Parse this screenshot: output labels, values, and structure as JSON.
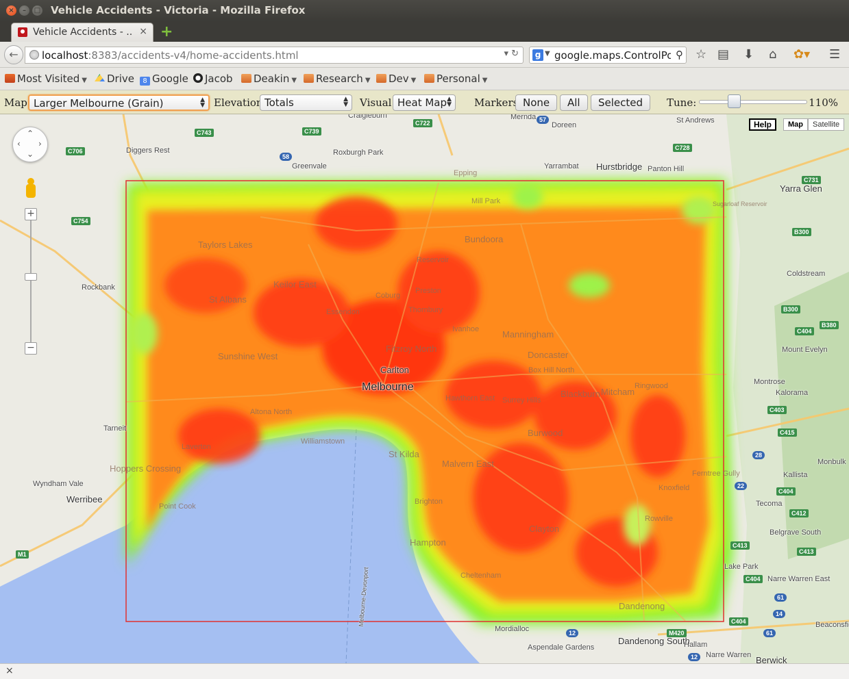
{
  "window": {
    "title": "Vehicle Accidents - Victoria - Mozilla Firefox",
    "close_glyph": "×",
    "min_glyph": "–",
    "max_glyph": "□"
  },
  "tab": {
    "title": "Vehicle Accidents - ...",
    "close": "×",
    "newtab": "+"
  },
  "navbar": {
    "url_host": "localhost",
    "url_path": ":8383/accidents-v4/home-accidents.html",
    "search_engine": "g",
    "search_text": "google.maps.ControlPositi",
    "icons": [
      "star-icon",
      "reading-list-icon",
      "download-icon",
      "home-icon",
      "extension-icon",
      "menu-icon"
    ]
  },
  "bookmarks": [
    {
      "label": "Most Visited",
      "icon": "visited",
      "dropdown": true
    },
    {
      "label": "Drive",
      "icon": "drive",
      "dropdown": false
    },
    {
      "label": "Google",
      "icon": "google",
      "dropdown": false
    },
    {
      "label": "Jacob",
      "icon": "jacob",
      "dropdown": false
    },
    {
      "label": "Deakin",
      "icon": "folder",
      "dropdown": true
    },
    {
      "label": "Research",
      "icon": "folder",
      "dropdown": true
    },
    {
      "label": "Dev",
      "icon": "folder",
      "dropdown": true
    },
    {
      "label": "Personal",
      "icon": "folder",
      "dropdown": true
    }
  ],
  "controls": {
    "map_label": "Map:",
    "map_value": "Larger Melbourne (Grain)",
    "elevation_label": "Elevation:",
    "elevation_value": "Totals",
    "visual_label": "Visual:",
    "visual_value": "Heat Map",
    "markers_label": "Markers:",
    "markers_none": "None",
    "markers_all": "All",
    "markers_selected": "Selected",
    "tune_label": "Tune:",
    "tune_value": "110%",
    "tune_level": 0.3
  },
  "map": {
    "help_label": "Help",
    "type_map": "Map",
    "type_satellite": "Satellite",
    "heat_color_hot": "#ff0000",
    "heat_color_warm": "#ffff00",
    "heat_color_cool": "#00ff00",
    "selection_color": "#e03030",
    "labels": {
      "melbourne": "Melbourne",
      "werribee": "Werribee",
      "carlton": "Carlton",
      "bundoora": "Bundoora",
      "manningham": "Manningham",
      "doncaster": "Doncaster",
      "dandenong_south": "Dandenong South",
      "hurstbridge": "Hurstbridge",
      "yarra_glen": "Yarra Glen",
      "coldstream": "Coldstream",
      "mount_evelyn": "Mount Evelyn",
      "montrose": "Montrose",
      "kalorama": "Kalorama",
      "monbulk": "Monbulk",
      "kallista": "Kallista",
      "tecoma": "Tecoma",
      "belgrave_south": "Belgrave South",
      "narre_warren_east": "Narre Warren East",
      "berwick": "Berwick",
      "hallam": "Hallam",
      "beaconsfield_upper": "Beaconsfield Upper",
      "wyndham_vale": "Wyndham Vale",
      "rockbank": "Rockbank",
      "diggers_rest": "Diggers Rest",
      "roxburgh_park": "Roxburgh Park",
      "greenvale": "Greenvale",
      "craigieburn": "Craigieburn",
      "mernda": "Mernda",
      "doreen": "Doreen",
      "yarrambat": "Yarrambat",
      "panton_hill": "Panton Hill",
      "st_andrews": "St Andrews",
      "tarneit": "Tarneit",
      "clayton": "Clayton",
      "malvern_east": "Malvern East",
      "st_kilda": "St Kilda",
      "hampton": "Hampton",
      "dandenong": "Dandenong",
      "ringwood": "Ringwood",
      "burwood": "Burwood",
      "mitcham": "Mitcham",
      "blackburn": "Blackburn",
      "sunshine_west": "Sunshine West",
      "st_albans": "St Albans",
      "taylors_lakes": "Taylors Lakes",
      "keilor_east": "Keilor East",
      "coburg": "Coburg",
      "preston": "Preston",
      "thornbury": "Thornbury",
      "ivanhoe": "Ivanhoe",
      "reservoir": "Reservoir",
      "fitzroy_north": "Fitzroy North",
      "essendon": "Essendon",
      "altona_north": "Altona North",
      "williamstown": "Williamstown",
      "laverton": "Laverton",
      "point_cook": "Point Cook",
      "hoppers_crossing": "Hoppers Crossing",
      "brighton": "Brighton",
      "cheltenham": "Cheltenham",
      "mordialloc": "Mordialloc",
      "aspendale_gardens": "Aspendale Gardens",
      "narre_warren": "Narre Warren",
      "hawthorn_east": "Hawthorn East",
      "box_hill_north": "Box Hill North",
      "surrey_hills": "Surrey Hills",
      "ferntree_gully": "Ferntree Gully",
      "knoxfield": "Knoxfield",
      "rowville": "Rowville",
      "lake_park": "Lake Park",
      "melbourne_devonport": "Melbourne-Devonport",
      "sugarloaf_reservoir": "Sugarloaf Reservoir",
      "epping": "Epping",
      "mill_park": "Mill Park"
    }
  },
  "status": {
    "close": "×"
  }
}
